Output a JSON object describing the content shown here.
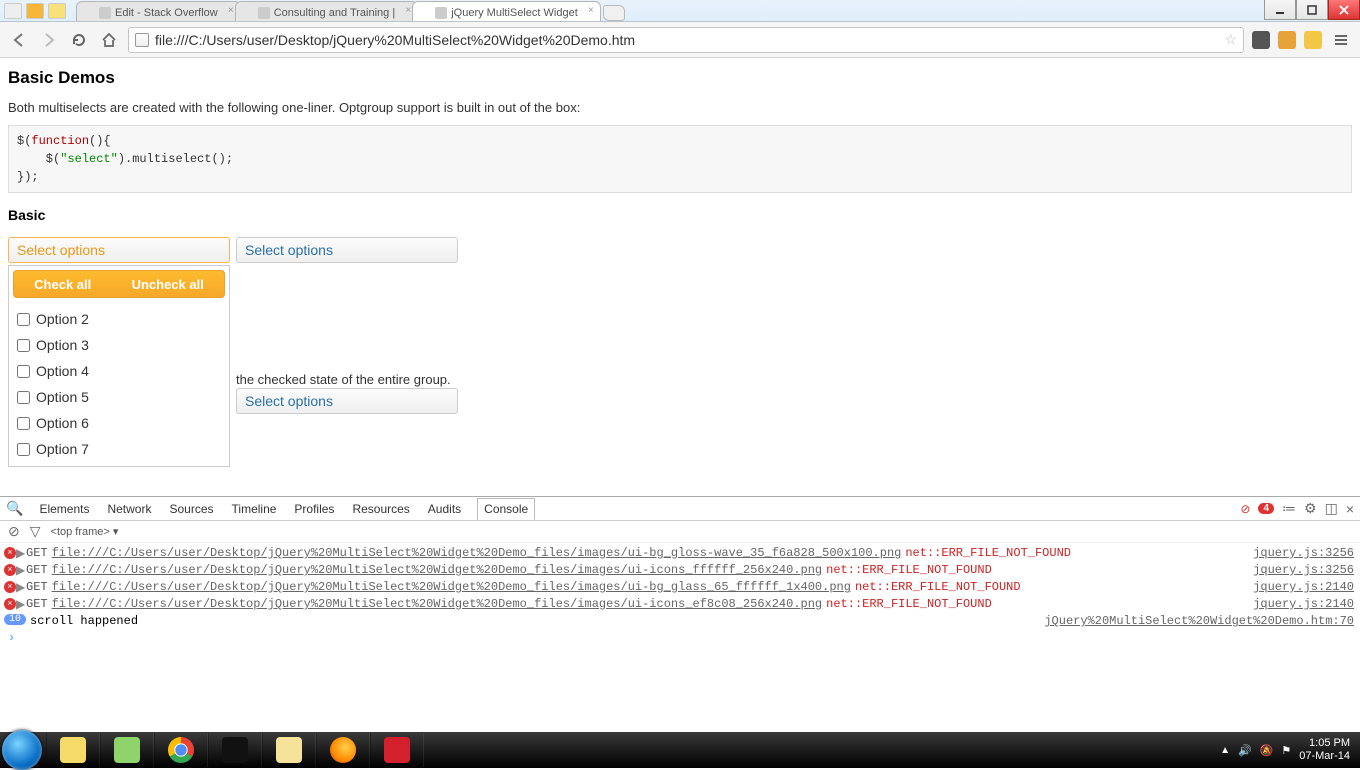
{
  "os": {
    "tabs": [
      {
        "title": "Edit - Stack Overflow"
      },
      {
        "title": "Consulting and Training |"
      },
      {
        "title": "jQuery MultiSelect Widget"
      }
    ],
    "active_tab": 2
  },
  "browser": {
    "url": "file:///C:/Users/user/Desktop/jQuery%20MultiSelect%20Widget%20Demo.htm"
  },
  "page": {
    "h2": "Basic Demos",
    "intro": "Both multiselects are created with the following one-liner. Optgroup support is built in out of the box:",
    "code": {
      "l1a": "$(",
      "l1b": "function",
      "l1c": "(){",
      "l2a": "    $(",
      "l2b": "\"select\"",
      "l2c": ").multiselect();",
      "l3": "});"
    },
    "h3": "Basic",
    "ms_button_label": "Select options",
    "ms_header": {
      "check": "Check all",
      "uncheck": "Uncheck all"
    },
    "options": [
      "Option 2",
      "Option 3",
      "Option 4",
      "Option 5",
      "Option 6",
      "Option 7"
    ],
    "behind_text": "the checked state of the entire group."
  },
  "devtools": {
    "tabs": [
      "Elements",
      "Network",
      "Sources",
      "Timeline",
      "Profiles",
      "Resources",
      "Audits",
      "Console"
    ],
    "active_tab": "Console",
    "error_count": "4",
    "subbar": {
      "frame": "<top frame>"
    },
    "lines": [
      {
        "method": "GET",
        "url": "file:///C:/Users/user/Desktop/jQuery%20MultiSelect%20Widget%20Demo_files/images/ui-bg_gloss-wave_35_f6a828_500x100.png",
        "err": "net::ERR_FILE_NOT_FOUND",
        "src": "jquery.js:3256"
      },
      {
        "method": "GET",
        "url": "file:///C:/Users/user/Desktop/jQuery%20MultiSelect%20Widget%20Demo_files/images/ui-icons_ffffff_256x240.png",
        "err": "net::ERR_FILE_NOT_FOUND",
        "src": "jquery.js:3256"
      },
      {
        "method": "GET",
        "url": "file:///C:/Users/user/Desktop/jQuery%20MultiSelect%20Widget%20Demo_files/images/ui-bg_glass_65_ffffff_1x400.png",
        "err": "net::ERR_FILE_NOT_FOUND",
        "src": "jquery.js:2140"
      },
      {
        "method": "GET",
        "url": "file:///C:/Users/user/Desktop/jQuery%20MultiSelect%20Widget%20Demo_files/images/ui-icons_ef8c08_256x240.png",
        "err": "net::ERR_FILE_NOT_FOUND",
        "src": "jquery.js:2140"
      }
    ],
    "log": {
      "count": "10",
      "msg": "scroll happened",
      "src": "jQuery%20MultiSelect%20Widget%20Demo.htm:70"
    }
  },
  "taskbar": {
    "time": "1:05 PM",
    "date": "07-Mar-14"
  }
}
